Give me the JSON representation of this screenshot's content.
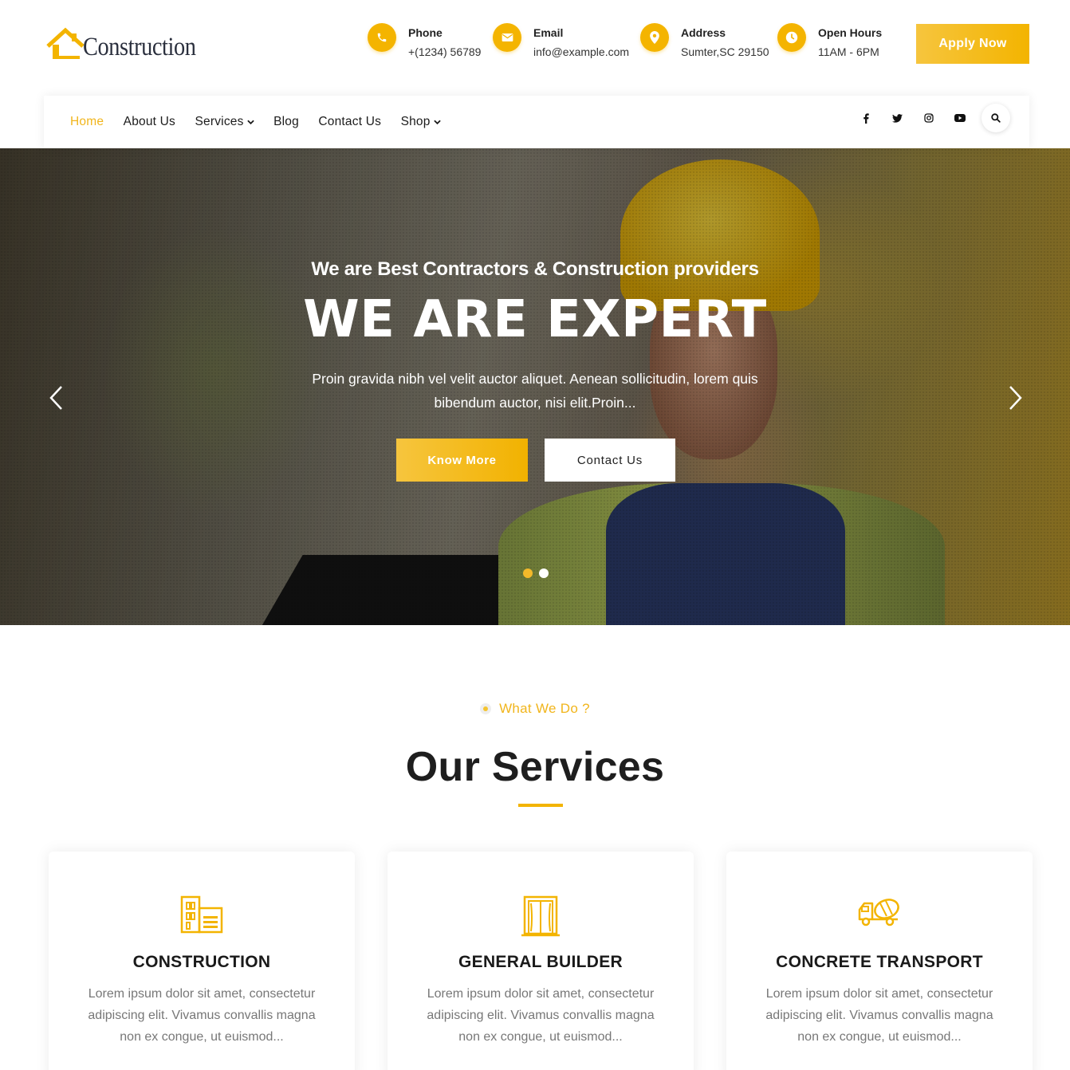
{
  "brand": {
    "name": "Construction"
  },
  "contacts": [
    {
      "title": "Phone",
      "value": "+(1234) 56789",
      "icon": "phone-icon"
    },
    {
      "title": "Email",
      "value": "info@example.com",
      "icon": "envelope-icon"
    },
    {
      "title": "Address",
      "value": "Sumter,SC 29150",
      "icon": "map-pin-icon"
    },
    {
      "title": "Open Hours",
      "value": "11AM - 6PM",
      "icon": "clock-icon"
    }
  ],
  "apply_button": "Apply Now",
  "nav": {
    "items": [
      {
        "label": "Home",
        "active": true
      },
      {
        "label": "About Us"
      },
      {
        "label": "Services",
        "dropdown": true
      },
      {
        "label": "Blog"
      },
      {
        "label": "Contact Us"
      },
      {
        "label": "Shop",
        "dropdown": true
      }
    ],
    "socials": [
      "facebook-icon",
      "twitter-icon",
      "instagram-icon",
      "youtube-icon"
    ]
  },
  "hero": {
    "subtitle": "We are Best Contractors & Construction providers",
    "title": "WE ARE EXPERT",
    "description": "Proin gravida nibh vel velit auctor aliquet. Aenean sollicitudin, lorem quis bibendum auctor, nisi elit.Proin...",
    "primary_button": "Know More",
    "secondary_button": "Contact Us",
    "slide_count": 2,
    "active_slide": 1
  },
  "services": {
    "eyebrow": "What We Do ?",
    "title": "Our Services",
    "cards": [
      {
        "title": "CONSTRUCTION",
        "icon": "buildings-icon",
        "desc": "Lorem ipsum dolor sit amet, consectetur adipiscing elit. Vivamus convallis magna non ex congue, ut euismod..."
      },
      {
        "title": "GENERAL BUILDER",
        "icon": "door-window-icon",
        "desc": "Lorem ipsum dolor sit amet, consectetur adipiscing elit. Vivamus convallis magna non ex congue, ut euismod..."
      },
      {
        "title": "CONCRETE TRANSPORT",
        "icon": "concrete-truck-icon",
        "desc": "Lorem ipsum dolor sit amet, consectetur adipiscing elit. Vivamus convallis magna non ex congue, ut euismod..."
      }
    ]
  },
  "colors": {
    "accent": "#f3b400",
    "text": "#222222",
    "muted": "#777777"
  }
}
